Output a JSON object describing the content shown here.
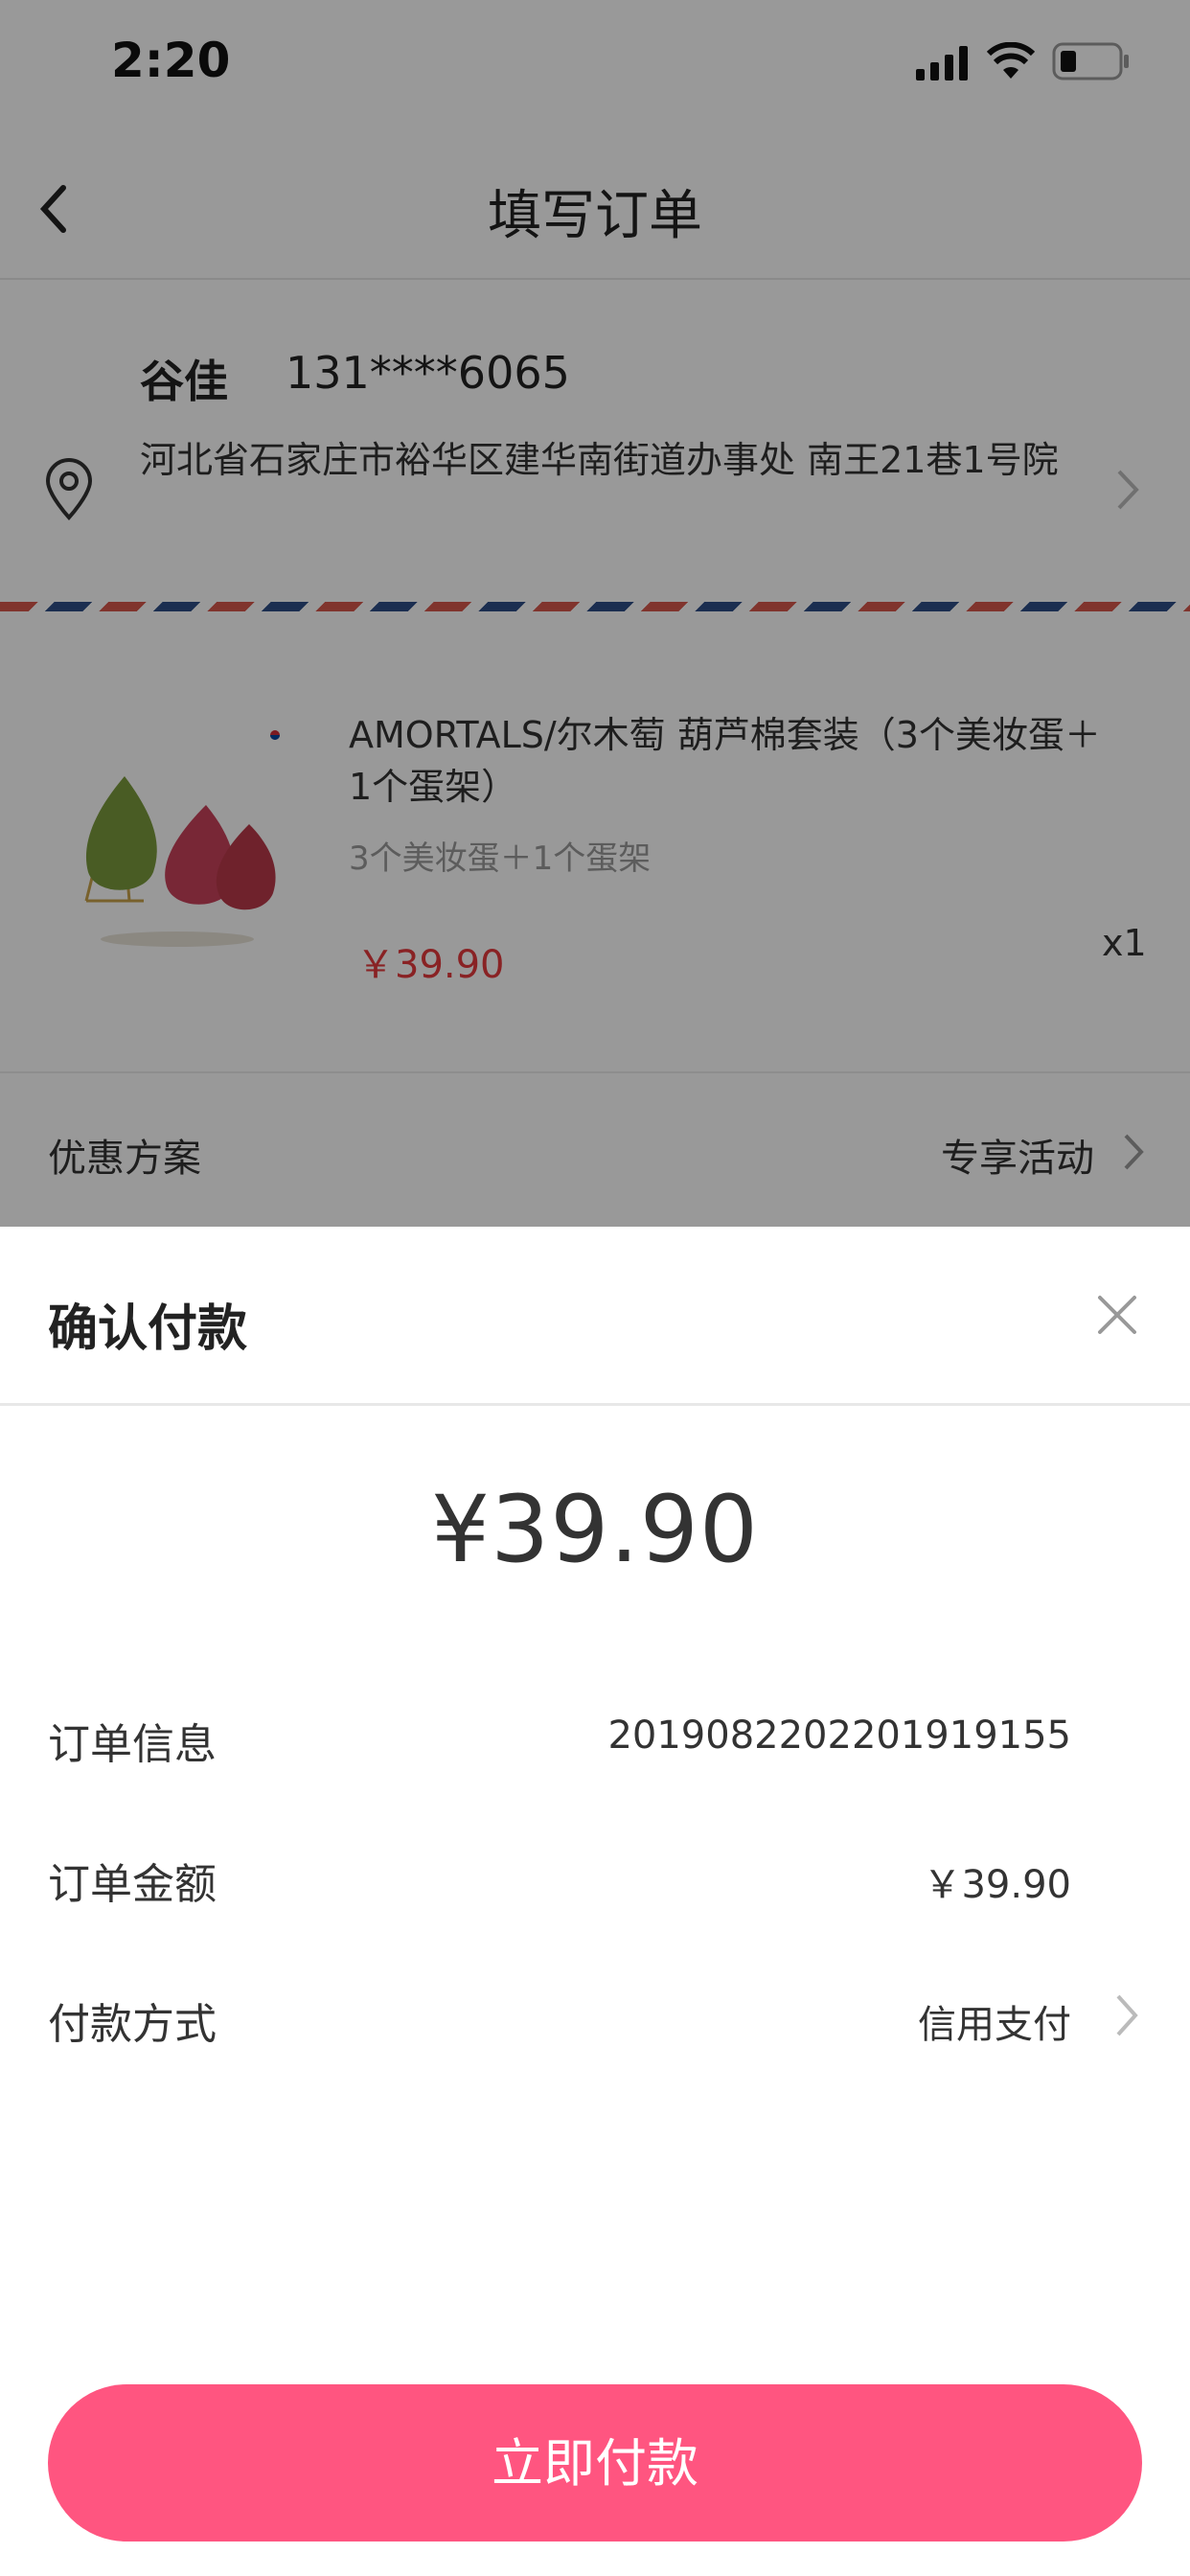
{
  "status_bar": {
    "time": "2:20"
  },
  "header": {
    "title": "填写订单"
  },
  "address": {
    "name": "谷佳",
    "phone": "131****6065",
    "text": "河北省石家庄市裕华区建华南街道办事处 南王21巷1号院"
  },
  "product": {
    "title": "AMORTALS/尔木萄 葫芦棉套装（3个美妆蛋＋1个蛋架）",
    "spec": "3个美妆蛋＋1个蛋架",
    "price": "￥39.90",
    "quantity": "x1"
  },
  "promotion": {
    "label": "优惠方案",
    "value": "专享活动"
  },
  "payment_sheet": {
    "title": "确认付款",
    "amount": "¥39.90",
    "rows": [
      {
        "label": "订单信息",
        "value": "2019082202201919155"
      },
      {
        "label": "订单金额",
        "value": "￥39.90"
      },
      {
        "label": "付款方式",
        "value": "信用支付"
      }
    ],
    "pay_button": "立即付款"
  },
  "colors": {
    "accent": "#ff5580",
    "price_red": "#e4393c",
    "overlay": "rgba(0,0,0,0.4)"
  }
}
